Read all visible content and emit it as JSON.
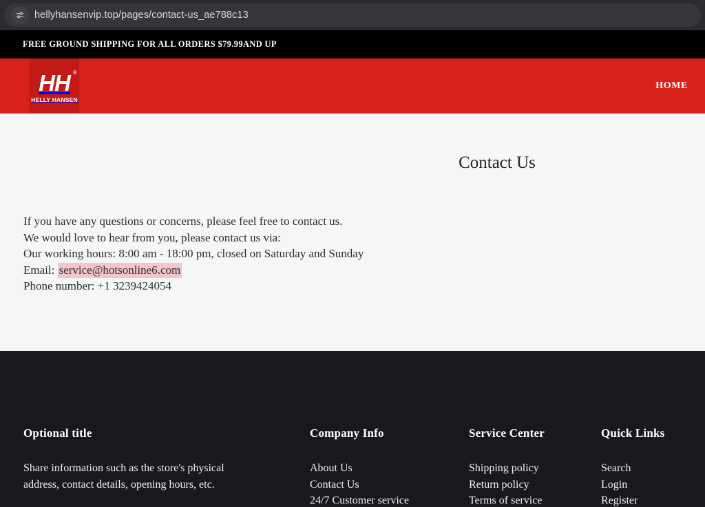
{
  "browser": {
    "site_settings_icon": "tune-sliders-icon",
    "url": "hellyhansenvip.top/pages/contact-us_ae788c13"
  },
  "announcement": {
    "text": "FREE GROUND SHIPPING FOR ALL ORDERS $79.99AND UP"
  },
  "header": {
    "logo": {
      "monogram": "HH",
      "registered_mark": "®",
      "wordmark": "HELLY HANSEN"
    },
    "nav": [
      {
        "label": "HOME"
      }
    ],
    "colors": {
      "header_red": "#d8211a",
      "logo_block_red": "#c21a16"
    }
  },
  "main": {
    "title": "Contact Us",
    "lines": [
      "If you have any questions or concerns, please feel free to contact us.",
      "We would love to hear from you, please contact us via:",
      "Our working hours: 8:00 am - 18:00 pm, closed on Saturday and Sunday"
    ],
    "email_label": "Email: ",
    "email": "service@hotsonline6.com",
    "email_highlight_color": "#f6c5ca",
    "phone": "Phone number: +1 3239424054"
  },
  "footer": {
    "background": "#17191e",
    "columns": [
      {
        "heading": "Optional title",
        "description": "Share information such as the store's physical address, contact details, opening hours, etc."
      },
      {
        "heading": "Company Info",
        "links": [
          "About Us",
          "Contact Us",
          "24/7 Customer service"
        ]
      },
      {
        "heading": "Service Center",
        "links": [
          "Shipping policy",
          "Return policy",
          "Terms of service"
        ]
      },
      {
        "heading": "Quick Links",
        "links": [
          "Search",
          "Login",
          "Register"
        ]
      }
    ]
  }
}
